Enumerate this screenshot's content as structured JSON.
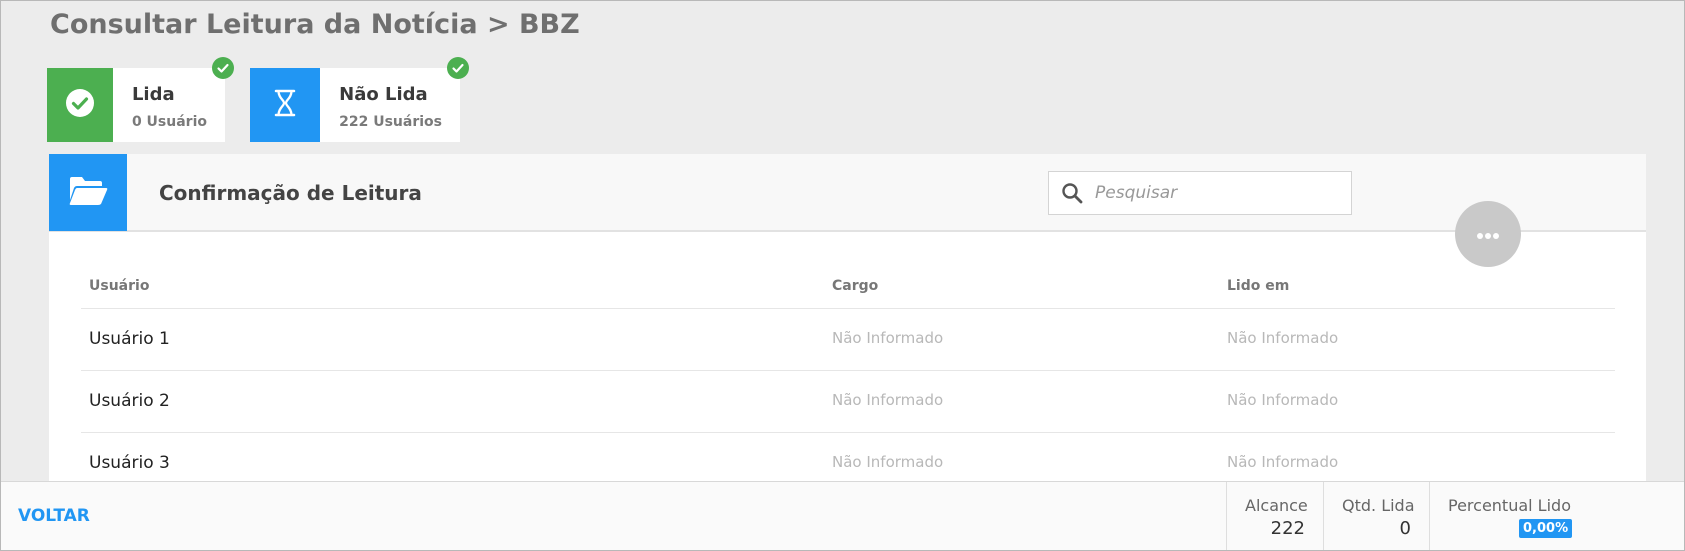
{
  "page": {
    "title": "Consultar Leitura da Notícia > BBZ"
  },
  "status_cards": [
    {
      "name": "Lida",
      "count": "0 Usuário",
      "color": "#4caf50",
      "icon": "check-circle-icon"
    },
    {
      "name": "Não Lida",
      "count": "222 Usuários",
      "color": "#2196f3",
      "icon": "hourglass-icon"
    }
  ],
  "panel": {
    "title": "Confirmação de Leitura",
    "icon": "folder-open-icon",
    "accent": "#2196f3",
    "search": {
      "placeholder": "Pesquisar",
      "value": ""
    },
    "more_icon": "ellipsis-icon"
  },
  "table": {
    "columns": [
      "Usuário",
      "Cargo",
      "Lido em"
    ],
    "rows": [
      [
        "Usuário 1",
        "Não Informado",
        "Não Informado"
      ],
      [
        "Usuário 2",
        "Não Informado",
        "Não Informado"
      ],
      [
        "Usuário 3",
        "Não Informado",
        "Não Informado"
      ]
    ]
  },
  "footer": {
    "back_label": "VOLTAR",
    "metrics": {
      "reach_label": "Alcance",
      "reach_value": "222",
      "read_label": "Qtd. Lida",
      "read_value": "0",
      "percent_label": "Percentual Lido",
      "percent_value": "0,00%"
    }
  }
}
